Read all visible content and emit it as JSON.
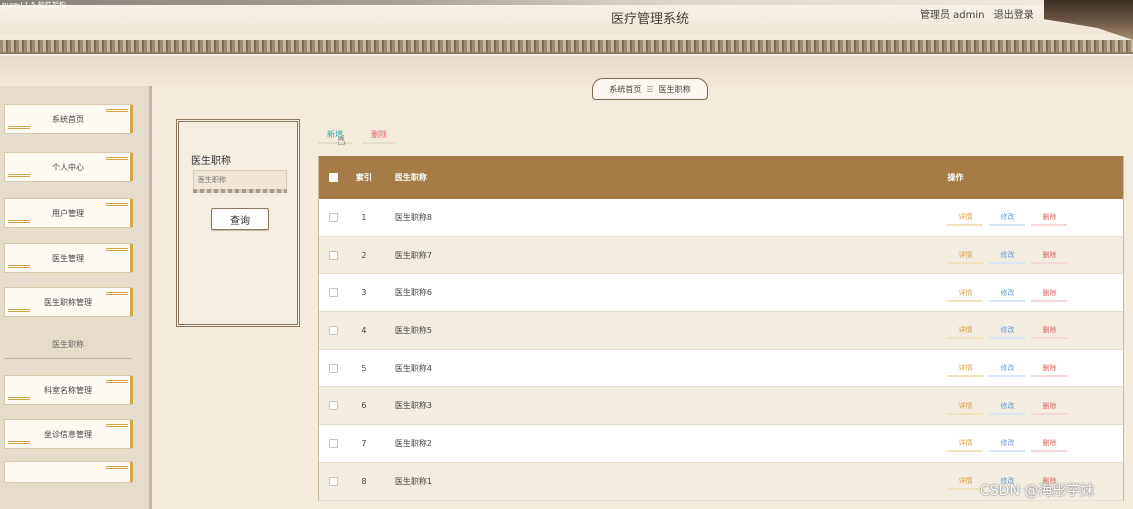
{
  "app": {
    "title": "医疗管理系统",
    "corner_note": "pure-L1.5.软件架构"
  },
  "user": {
    "role_name": "管理员 admin",
    "logout": "退出登录"
  },
  "breadcrumb": {
    "home": "系统首页",
    "separator": "☰",
    "current": "医生职称"
  },
  "sidebar": {
    "items": [
      {
        "label": "系统首页"
      },
      {
        "label": "个人中心"
      },
      {
        "label": "用户管理"
      },
      {
        "label": "医生管理"
      },
      {
        "label": "医生职称管理"
      }
    ],
    "sub_item": "医生职称",
    "items_after": [
      {
        "label": "科室名称管理"
      },
      {
        "label": "坐诊信息管理"
      },
      {
        "label": ""
      }
    ]
  },
  "search": {
    "label": "医生职称",
    "placeholder": "医生职称",
    "button": "查询"
  },
  "actions": {
    "add": "新增",
    "delete": "删除"
  },
  "table": {
    "headers": {
      "index": "索引",
      "name": "医生职称",
      "ops": "操作"
    },
    "rows": [
      {
        "index": "1",
        "name": "医生职称8"
      },
      {
        "index": "2",
        "name": "医生职称7"
      },
      {
        "index": "3",
        "name": "医生职称6"
      },
      {
        "index": "4",
        "name": "医生职称5"
      },
      {
        "index": "5",
        "name": "医生职称4"
      },
      {
        "index": "6",
        "name": "医生职称3"
      },
      {
        "index": "7",
        "name": "医生职称2"
      },
      {
        "index": "8",
        "name": "医生职称1"
      }
    ],
    "op_labels": {
      "detail": "详情",
      "edit": "修改",
      "delete": "删除"
    }
  },
  "watermark": "CSDN @海彤学妹",
  "colors": {
    "header_bar": "#a57c47",
    "add": "#2aa8a0",
    "delete": "#e06666",
    "edit": "#6b9bd6",
    "detail": "#d4a447"
  }
}
